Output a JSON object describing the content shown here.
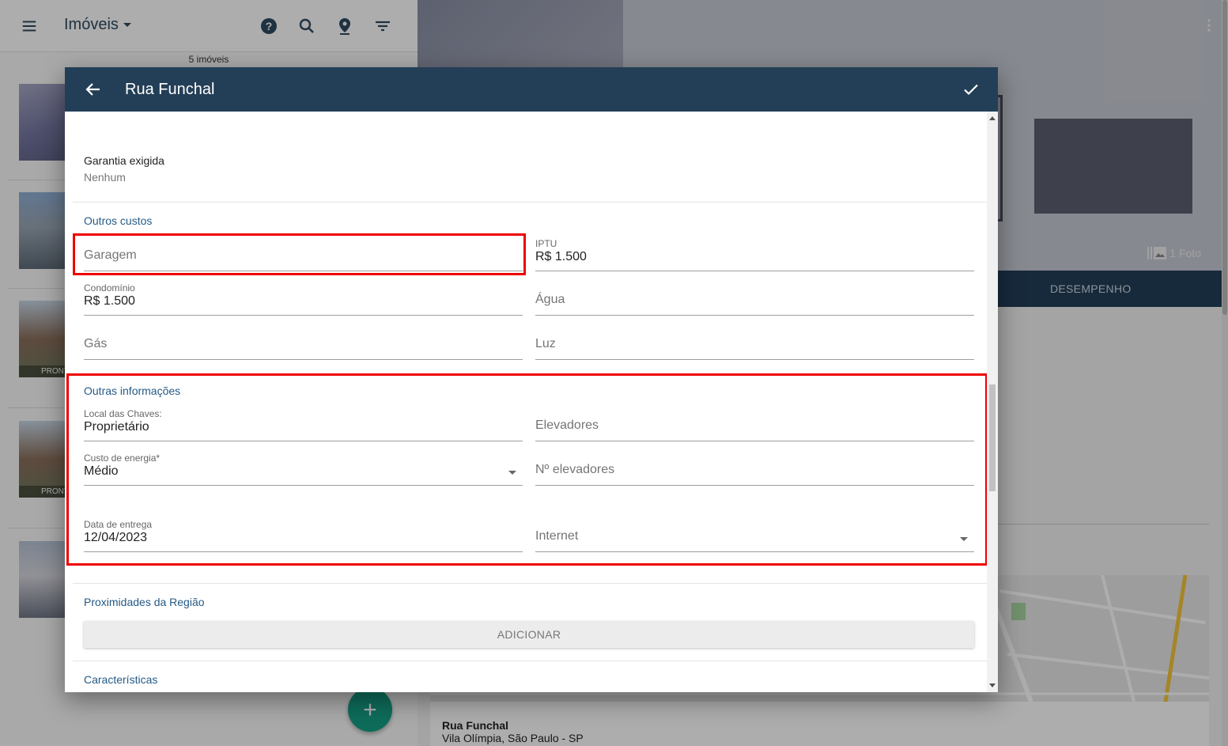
{
  "background": {
    "app_title": "Imóveis",
    "listing_count": "5 imóveis",
    "thumbnails": [
      {
        "tag": ""
      },
      {
        "tag": ""
      },
      {
        "tag": "PRONTO"
      },
      {
        "tag": "PRONTO"
      },
      {
        "tag": ""
      }
    ],
    "photo_count": "1 Foto",
    "tab_label": "DESEMPENHO",
    "address_street": "Rua Funchal",
    "address_region": "Vila Olímpia, São Paulo - SP"
  },
  "dialog": {
    "title": "Rua Funchal",
    "guarantee": {
      "label": "Garantia exigida",
      "value": "Nenhum"
    },
    "other_costs": {
      "section_title": "Outros custos",
      "garagem": {
        "placeholder": "Garagem",
        "value": ""
      },
      "iptu": {
        "label": "IPTU",
        "value": "R$ 1.500"
      },
      "condominio": {
        "label": "Condomínio",
        "value": "R$ 1.500"
      },
      "agua": {
        "placeholder": "Água",
        "value": ""
      },
      "gas": {
        "placeholder": "Gás",
        "value": ""
      },
      "luz": {
        "placeholder": "Luz",
        "value": ""
      }
    },
    "other_info": {
      "section_title": "Outras informações",
      "local_chaves": {
        "label": "Local das Chaves:",
        "value": "Proprietário"
      },
      "elevadores": {
        "placeholder": "Elevadores",
        "value": ""
      },
      "custo_energia": {
        "label": "Custo de energia*",
        "value": "Médio"
      },
      "num_elevadores": {
        "placeholder": "Nº elevadores",
        "value": ""
      },
      "data_entrega": {
        "label": "Data de entrega",
        "value": "12/04/2023"
      },
      "internet": {
        "placeholder": "Internet",
        "value": ""
      }
    },
    "proximities": {
      "section_title": "Proximidades da Região",
      "add_label": "ADICIONAR"
    },
    "features": {
      "section_title": "Características"
    }
  },
  "colors": {
    "header": "#233f57",
    "section_title": "#255a85",
    "highlight": "#ee0000",
    "fab": "#15a087"
  }
}
